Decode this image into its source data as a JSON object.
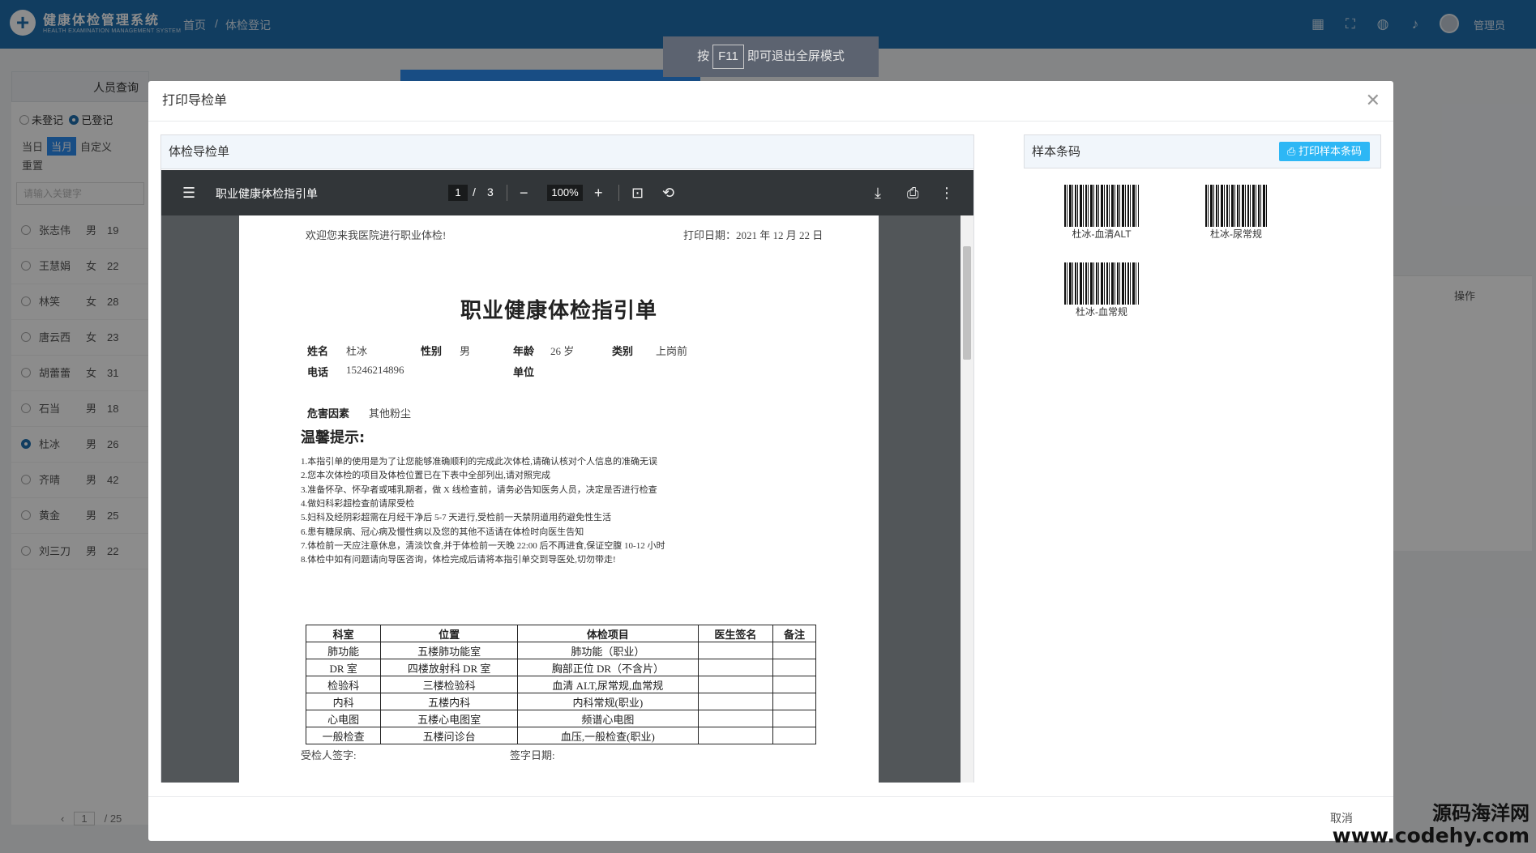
{
  "header": {
    "app_title": "健康体检管理系统",
    "app_subtitle": "HEALTH EXAMINATION MANAGEMENT SYSTEM",
    "breadcrumb_home": "首页",
    "breadcrumb_sep": "/",
    "breadcrumb_current": "体检登记",
    "user_name": "管理员"
  },
  "fullscreen_hint": {
    "prefix": "按",
    "key": "F11",
    "suffix": "即可退出全屏模式"
  },
  "left_panel": {
    "title": "人员查询",
    "radio_unregistered": "未登记",
    "radio_registered": "已登记",
    "date_tabs": [
      "当日",
      "当月",
      "自定义",
      "重置"
    ],
    "search_placeholder": "请输入关键字",
    "people": [
      {
        "name": "张志伟",
        "sex": "男",
        "age": "19",
        "selected": false
      },
      {
        "name": "王慧娟",
        "sex": "女",
        "age": "22",
        "selected": false
      },
      {
        "name": "林笑",
        "sex": "女",
        "age": "28",
        "selected": false
      },
      {
        "name": "唐云西",
        "sex": "女",
        "age": "23",
        "selected": false
      },
      {
        "name": "胡蕾蕾",
        "sex": "女",
        "age": "31",
        "selected": false
      },
      {
        "name": "石当",
        "sex": "男",
        "age": "18",
        "selected": false
      },
      {
        "name": "杜冰",
        "sex": "男",
        "age": "26",
        "selected": true
      },
      {
        "name": "齐晴",
        "sex": "男",
        "age": "42",
        "selected": false
      },
      {
        "name": "黄金",
        "sex": "男",
        "age": "25",
        "selected": false
      },
      {
        "name": "刘三刀",
        "sex": "男",
        "age": "22",
        "selected": false
      }
    ],
    "pager": {
      "current": "1",
      "sep": "/",
      "total": "25"
    }
  },
  "background": {
    "table_op_header": "操作"
  },
  "modal": {
    "title": "打印导检单",
    "left_card_title": "体检导检单",
    "right_card_title": "样本条码",
    "print_barcode_label": "打印样本条码",
    "cancel_label": "取消"
  },
  "viewer": {
    "file_title": "职业健康体检指引单",
    "page_current": "1",
    "page_sep": "/",
    "page_total": "3",
    "zoom": "100%"
  },
  "document": {
    "welcome": "欢迎您来我医院进行职业体检!",
    "print_date": "打印日期：2021 年 12 月 22 日",
    "title": "职业健康体检指引单",
    "labels": {
      "name": "姓名",
      "sex": "性别",
      "age": "年龄",
      "category": "类别",
      "phone": "电话",
      "unit": "单位",
      "hazard": "危害因素"
    },
    "values": {
      "name": "杜冰",
      "sex": "男",
      "age": "26 岁",
      "category": "上岗前",
      "phone": "15246214896",
      "unit": "",
      "hazard": "其他粉尘"
    },
    "tips_title": "温馨提示:",
    "tips": [
      "1.本指引单的使用是为了让您能够准确顺利的完成此次体检,请确认核对个人信息的准确无误",
      "2.您本次体检的项目及体检位置已在下表中全部列出,请对照完成",
      "3.准备怀孕、怀孕者或哺乳期者，做 X 线检查前，请务必告知医务人员，决定是否进行检查",
      "4.做妇科彩超检查前请尿受检",
      "5.妇科及经阴彩超需在月经干净后 5-7 天进行,受检前一天禁阴道用药避免性生活",
      "6.患有糖尿病、冠心病及慢性病以及您的其他不适请在体检时向医生告知",
      "7.体检前一天应注意休息，清淡饮食,并于体检前一天晚 22:00 后不再进食,保证空腹 10-12 小时",
      "8.体检中如有问题请向导医咨询，体检完成后请将本指引单交到导医处,切勿带走!"
    ],
    "table": {
      "headers": [
        "科室",
        "位置",
        "体检项目",
        "医生签名",
        "备注"
      ],
      "rows": [
        [
          "肺功能",
          "五楼肺功能室",
          "肺功能（职业）",
          "",
          ""
        ],
        [
          "DR 室",
          "四楼放射科 DR 室",
          "胸部正位 DR（不含片）",
          "",
          ""
        ],
        [
          "检验科",
          "三楼检验科",
          "血清 ALT,尿常规,血常规",
          "",
          ""
        ],
        [
          "内科",
          "五楼内科",
          "内科常规(职业)",
          "",
          ""
        ],
        [
          "心电图",
          "五楼心电图室",
          "频谱心电图",
          "",
          ""
        ],
        [
          "一般检查",
          "五楼问诊台",
          "血压,一般检查(职业)",
          "",
          ""
        ]
      ]
    },
    "sign_examinee": "受检人签字:",
    "sign_date": "签字日期:"
  },
  "barcodes": [
    {
      "label": "杜冰-血清ALT"
    },
    {
      "label": "杜冰-尿常规"
    },
    {
      "label": "杜冰-血常规"
    }
  ],
  "watermark": {
    "line1": "源码海洋网",
    "line2": "www.codehy.com"
  },
  "colors": {
    "topbar": "#1f6fb0",
    "accent": "#2d8cf0",
    "print_button": "#2db7f5",
    "viewer_toolbar": "#323639"
  }
}
